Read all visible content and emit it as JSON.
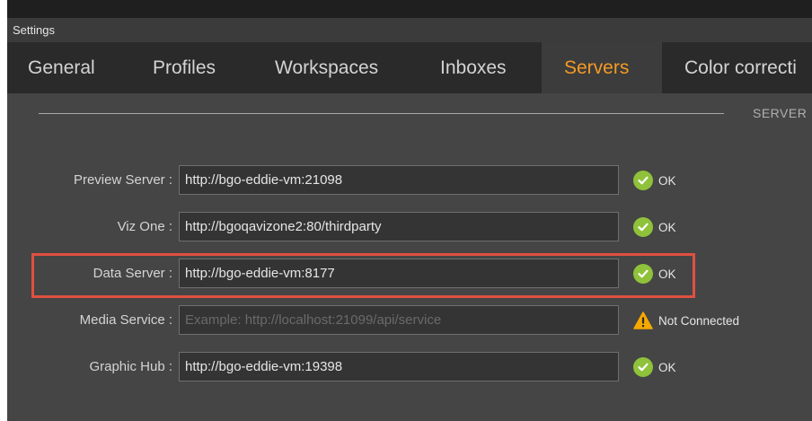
{
  "window": {
    "title": "Settings"
  },
  "tabs": [
    {
      "label": "General"
    },
    {
      "label": "Profiles"
    },
    {
      "label": "Workspaces"
    },
    {
      "label": "Inboxes"
    },
    {
      "label": "Servers"
    },
    {
      "label": "Color correcti"
    }
  ],
  "active_tab": "Servers",
  "section": {
    "label": "SERVER"
  },
  "servers": [
    {
      "label": "Preview Server :",
      "value": "http://bgo-eddie-vm:21098",
      "status": "OK",
      "status_icon": "check-circle-icon"
    },
    {
      "label": "Viz One :",
      "value": "http://bgoqavizone2:80/thirdparty",
      "status": "OK",
      "status_icon": "check-circle-icon"
    },
    {
      "label": "Data Server :",
      "value": "http://bgo-eddie-vm:8177",
      "status": "OK",
      "status_icon": "check-circle-icon"
    },
    {
      "label": "Media Service :",
      "value": "",
      "placeholder": "Example: http://localhost:21099/api/service",
      "status": "Not Connected",
      "status_icon": "warning-icon"
    },
    {
      "label": "Graphic Hub :",
      "value": "http://bgo-eddie-vm:19398",
      "status": "OK",
      "status_icon": "check-circle-icon"
    }
  ],
  "colors": {
    "accent": "#f59a23",
    "ok": "#8fc23a",
    "warning": "#f5a800",
    "highlight": "#e05040"
  }
}
